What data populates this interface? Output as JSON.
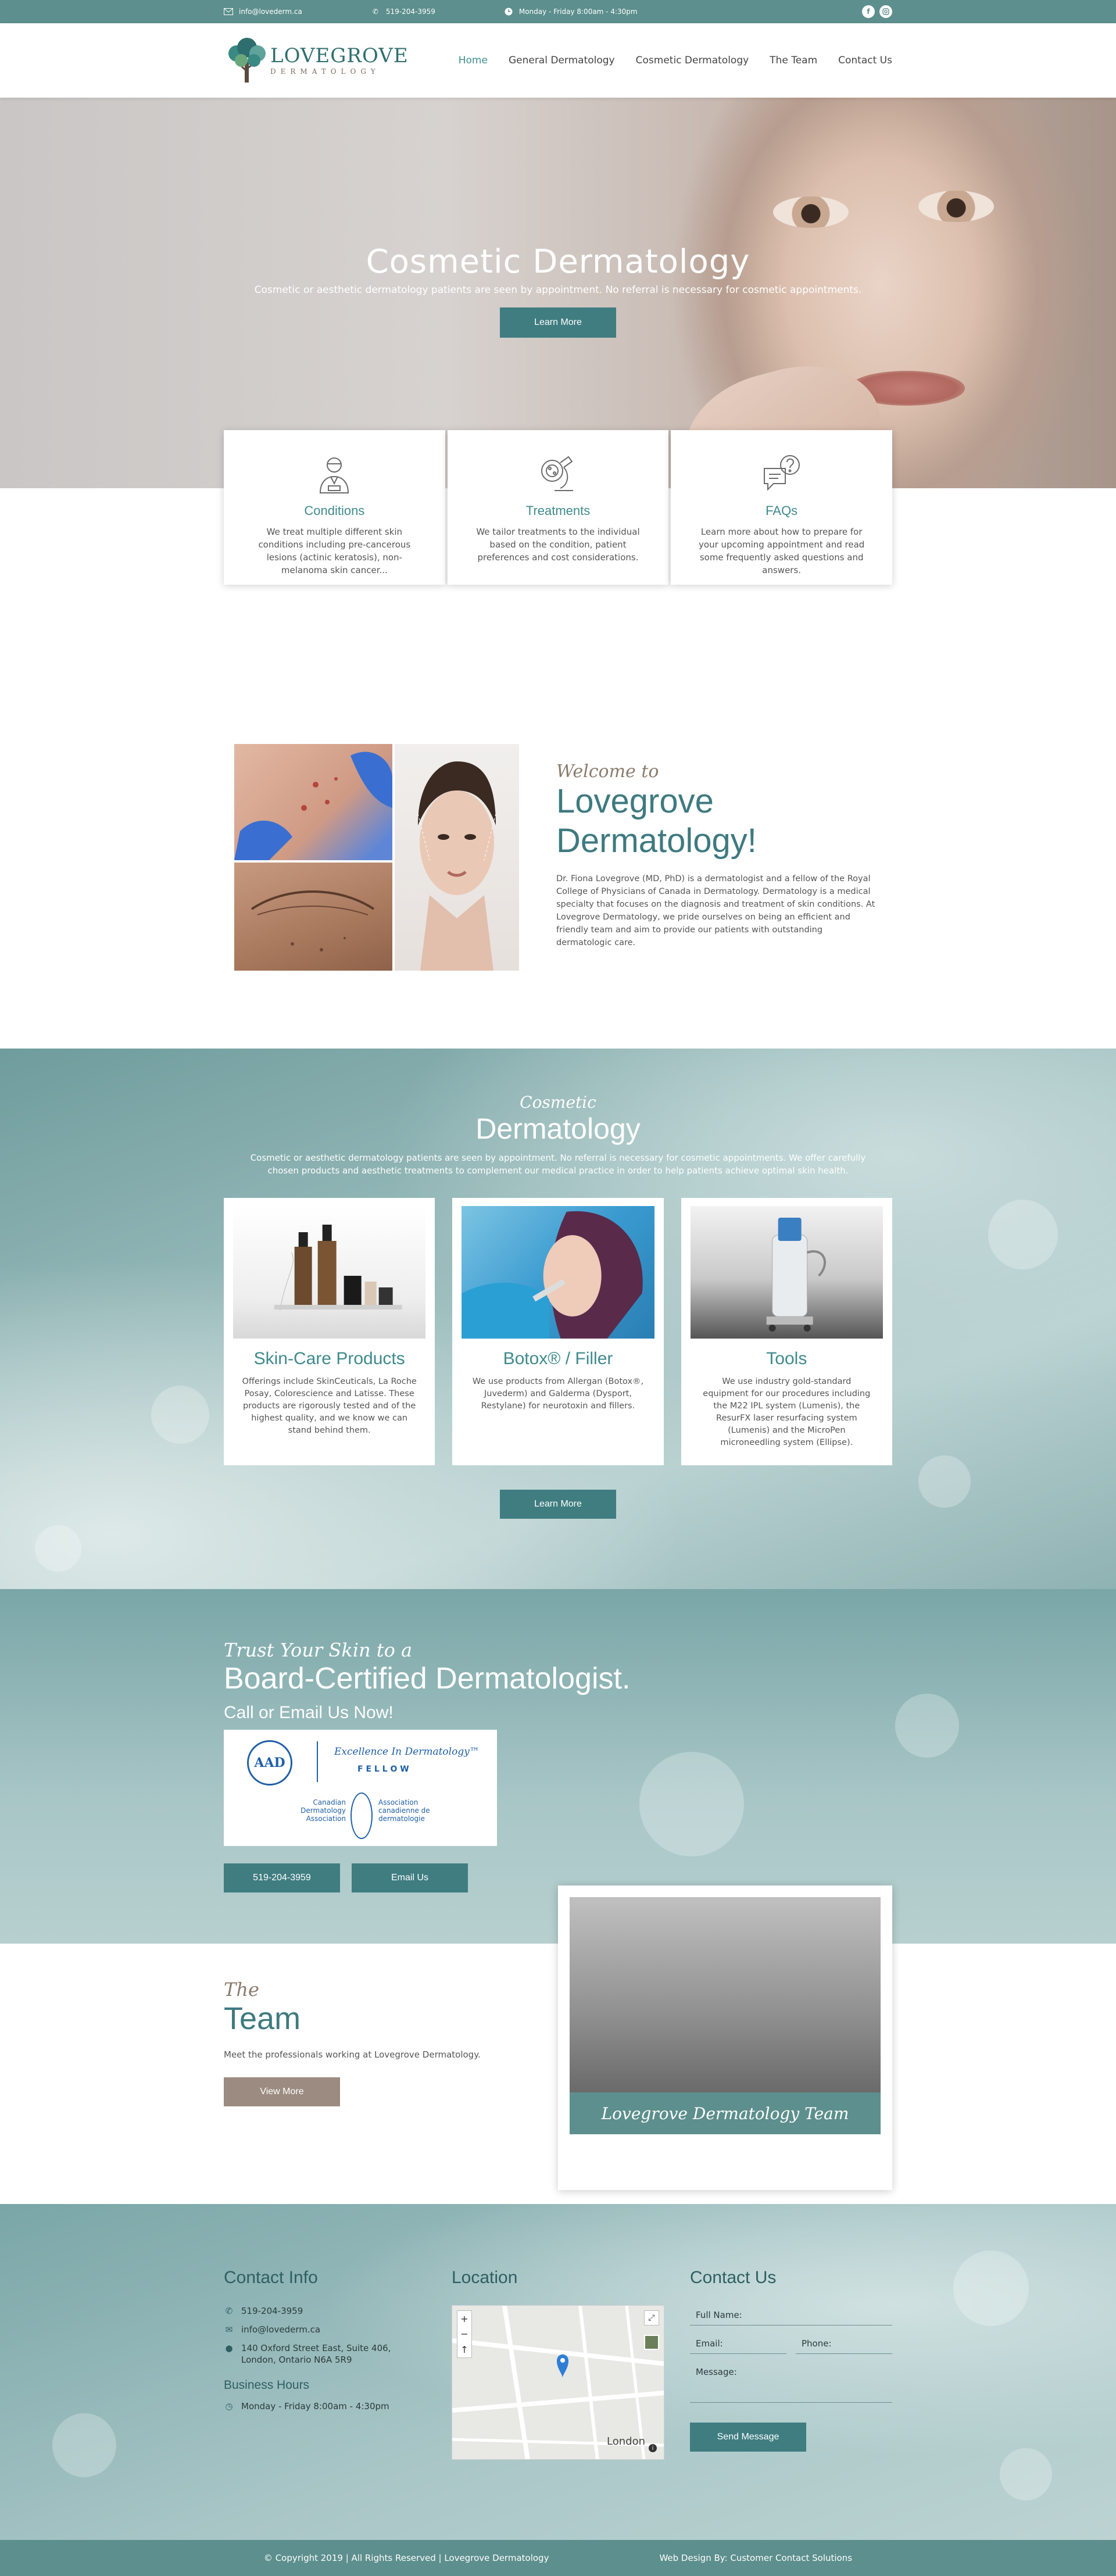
{
  "topbar": {
    "email": "info@lovederm.ca",
    "phone": "519-204-3959",
    "hours": "Monday - Friday 8:00am - 4:30pm",
    "social": [
      "f",
      "ig"
    ]
  },
  "logo": {
    "line1": "LOVEGROVE",
    "line2": "DERMATOLOGY"
  },
  "nav": [
    "Home",
    "General Dermatology",
    "Cosmetic Dermatology",
    "The Team",
    "Contact Us"
  ],
  "hero": {
    "title": "Cosmetic Dermatology",
    "subtitle": "Cosmetic or aesthetic dermatology patients are seen by appointment. No referral is necessary for cosmetic appointments.",
    "button": "Learn More"
  },
  "features": [
    {
      "title": "Conditions",
      "text": "We treat multiple different skin conditions including pre-cancerous lesions (actinic keratosis), non-melanoma skin cancer..."
    },
    {
      "title": "Treatments",
      "text": "We tailor treatments to the individual based on the condition, patient preferences and cost considerations."
    },
    {
      "title": "FAQs",
      "text": "Learn more about how to prepare for your upcoming appointment and read some frequently asked questions and answers."
    }
  ],
  "welcome": {
    "script": "Welcome to",
    "title": "Lovegrove Dermatology!",
    "text": "Dr. Fiona Lovegrove (MD, PhD) is a dermatologist and a fellow of the Royal College of Physicians of Canada in Dermatology. Dermatology is a medical specialty that focuses on the diagnosis and treatment of skin conditions. At Lovegrove Dermatology, we pride ourselves on being an efficient and friendly team and aim to provide our patients with outstanding dermatologic care."
  },
  "cosmetic": {
    "script": "Cosmetic",
    "title": "Dermatology",
    "text": "Cosmetic or aesthetic dermatology patients are seen by appointment. No referral is necessary for cosmetic appointments. We offer carefully chosen products and aesthetic treatments to complement our medical practice in order to help patients achieve optimal skin health.",
    "products": [
      {
        "title": "Skin-Care Products",
        "text": "Offerings include SkinCeuticals, La Roche Posay, Colorescience and Latisse. These products are rigorously tested and of the highest quality, and we know we can stand behind them."
      },
      {
        "title": "Botox® / Filler",
        "text": "We use products from Allergan (Botox®, Juvederm) and Galderma (Dysport, Restylane) for neurotoxin and fillers."
      },
      {
        "title": "Tools",
        "text": "We use industry gold-standard equipment for our procedures including the M22 IPL system (Lumenis), the ResurFX laser resurfacing system (Lumenis) and the MicroPen microneedling system (Ellipse)."
      }
    ],
    "button": "Learn More"
  },
  "board": {
    "script": "Trust Your Skin to a",
    "title": "Board-Certified Dermatologist.",
    "subtitle": "Call or Email Us Now!",
    "aad": {
      "badge": "AAD",
      "excellence": "Excellence In Dermatology™",
      "fellow": "F E L L O W",
      "cda_en": "Canadian Dermatology Association",
      "cda_fr": "Association canadienne de dermatologie"
    },
    "phone_button": "519-204-3959",
    "email_button": "Email Us"
  },
  "team": {
    "script": "The",
    "title": "Team",
    "text": "Meet the professionals working at Lovegrove Dermatology.",
    "button": "View More",
    "caption": "Lovegrove Dermatology Team"
  },
  "contact": {
    "info_title": "Contact Info",
    "phone": "519-204-3959",
    "email": "info@lovederm.ca",
    "address": "140 Oxford Street East, Suite 406, London, Ontario N6A 5R9",
    "hours_title": "Business Hours",
    "hours": "Monday - Friday 8:00am - 4:30pm",
    "location_title": "Location",
    "map_city": "London",
    "form_title": "Contact Us",
    "form": {
      "name": "Full Name:",
      "email": "Email:",
      "phone": "Phone:",
      "message": "Message:",
      "button": "Send Message"
    }
  },
  "footer": {
    "copyright": "© Copyright 2019 | All Rights Reserved | Lovegrove Dermatology",
    "credit": "Web Design By: Customer Contact Solutions"
  }
}
